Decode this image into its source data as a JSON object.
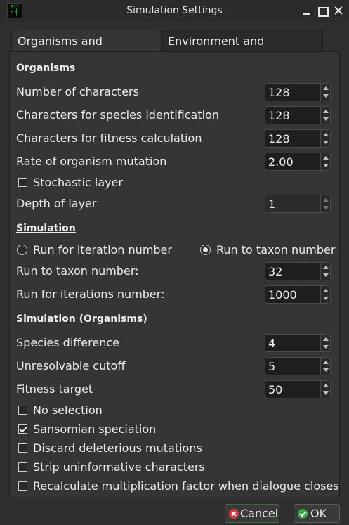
{
  "window": {
    "title": "Simulation Settings",
    "app_icon_text": "011",
    "controls": [
      "minimize-icon",
      "maximize-icon",
      "close-icon"
    ]
  },
  "tabs": [
    {
      "label": "Organisms and simulation",
      "active": true
    },
    {
      "label": "Environment and extinction",
      "active": false
    }
  ],
  "organisms": {
    "heading": "Organisms",
    "num_characters": {
      "label": "Number of characters",
      "value": "128"
    },
    "species_id_chars": {
      "label": "Characters for species identification",
      "value": "128"
    },
    "fitness_chars": {
      "label": "Characters for fitness calculation",
      "value": "128"
    },
    "mutation_rate": {
      "label": "Rate of organism mutation",
      "value": "2.00"
    },
    "stochastic_layer": {
      "label": "Stochastic layer",
      "checked": false
    },
    "layer_depth": {
      "label": "Depth of layer",
      "value": "1",
      "enabled": false
    }
  },
  "simulation": {
    "heading": "Simulation",
    "run_iteration_label": "Run for iteration number",
    "run_taxon_label": "Run to taxon number",
    "selected_mode": "Run to taxon number",
    "taxon_number": {
      "label": "Run to taxon number:",
      "value": "32"
    },
    "iterations_number": {
      "label": "Run for iterations number:",
      "value": "1000"
    }
  },
  "sim_organisms": {
    "heading": "Simulation (Organisms)",
    "species_difference": {
      "label": "Species difference",
      "value": "4"
    },
    "unresolvable_cutoff": {
      "label": "Unresolvable cutoff",
      "value": "5"
    },
    "fitness_target": {
      "label": "Fitness target",
      "value": "50"
    },
    "no_selection": {
      "label": "No selection",
      "checked": false
    },
    "sansomian_speciation": {
      "label": "Sansomian speciation",
      "checked": true
    },
    "discard_deleterious": {
      "label": "Discard deleterious mutations",
      "checked": false
    },
    "strip_uninformative": {
      "label": "Strip uninformative characters",
      "checked": false
    },
    "recalculate_factor": {
      "label": "Recalculate multiplication factor when dialogue closes",
      "checked": false
    }
  },
  "buttons": {
    "cancel": "Cancel",
    "ok": "OK"
  },
  "colors": {
    "background": "#2f2f2f",
    "panel": "#353535",
    "input": "#1e1e1e",
    "cancel_icon": "#d03a3a",
    "ok_icon": "#3aa84a"
  }
}
